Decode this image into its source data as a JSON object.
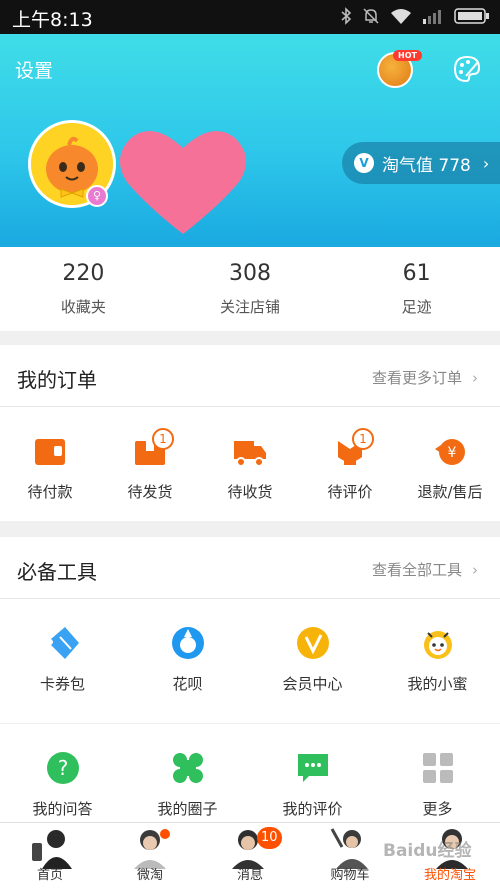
{
  "status_bar": {
    "time": "上午8:13"
  },
  "header": {
    "settings_label": "设置",
    "hot_badge": "HOT",
    "taoqi_label": "淘气值 778",
    "taoqi_badge": "V"
  },
  "stats": [
    {
      "value": "220",
      "label": "收藏夹"
    },
    {
      "value": "308",
      "label": "关注店铺"
    },
    {
      "value": "61",
      "label": "足迹"
    }
  ],
  "orders": {
    "title": "我的订单",
    "more_label": "查看更多订单",
    "items": [
      {
        "label": "待付款",
        "icon": "wallet-icon"
      },
      {
        "label": "待发货",
        "icon": "package-icon",
        "badge": "1"
      },
      {
        "label": "待收货",
        "icon": "truck-icon"
      },
      {
        "label": "待评价",
        "icon": "review-icon",
        "badge": "1"
      },
      {
        "label": "退款/售后",
        "icon": "refund-icon"
      }
    ]
  },
  "tools": {
    "title": "必备工具",
    "more_label": "查看全部工具",
    "row1": [
      {
        "label": "卡券包",
        "icon": "coupon-icon"
      },
      {
        "label": "花呗",
        "icon": "huabei-icon"
      },
      {
        "label": "会员中心",
        "icon": "member-icon"
      },
      {
        "label": "我的小蜜",
        "icon": "assistant-icon"
      }
    ],
    "row2": [
      {
        "label": "我的问答",
        "icon": "question-icon"
      },
      {
        "label": "我的圈子",
        "icon": "circle-icon"
      },
      {
        "label": "我的评价",
        "icon": "comment-icon"
      },
      {
        "label": "更多",
        "icon": "more-grid-icon"
      }
    ]
  },
  "tabbar": [
    {
      "label": "首页"
    },
    {
      "label": "微淘"
    },
    {
      "label": "消息",
      "badge": "10"
    },
    {
      "label": "购物车"
    },
    {
      "label": "我的淘宝"
    }
  ],
  "watermark": "Baidu经验",
  "colors": {
    "accent": "#ff5000",
    "icon_orange": "#f26a12",
    "header_top": "#3fdde8",
    "header_bottom": "#1aa9e0"
  }
}
